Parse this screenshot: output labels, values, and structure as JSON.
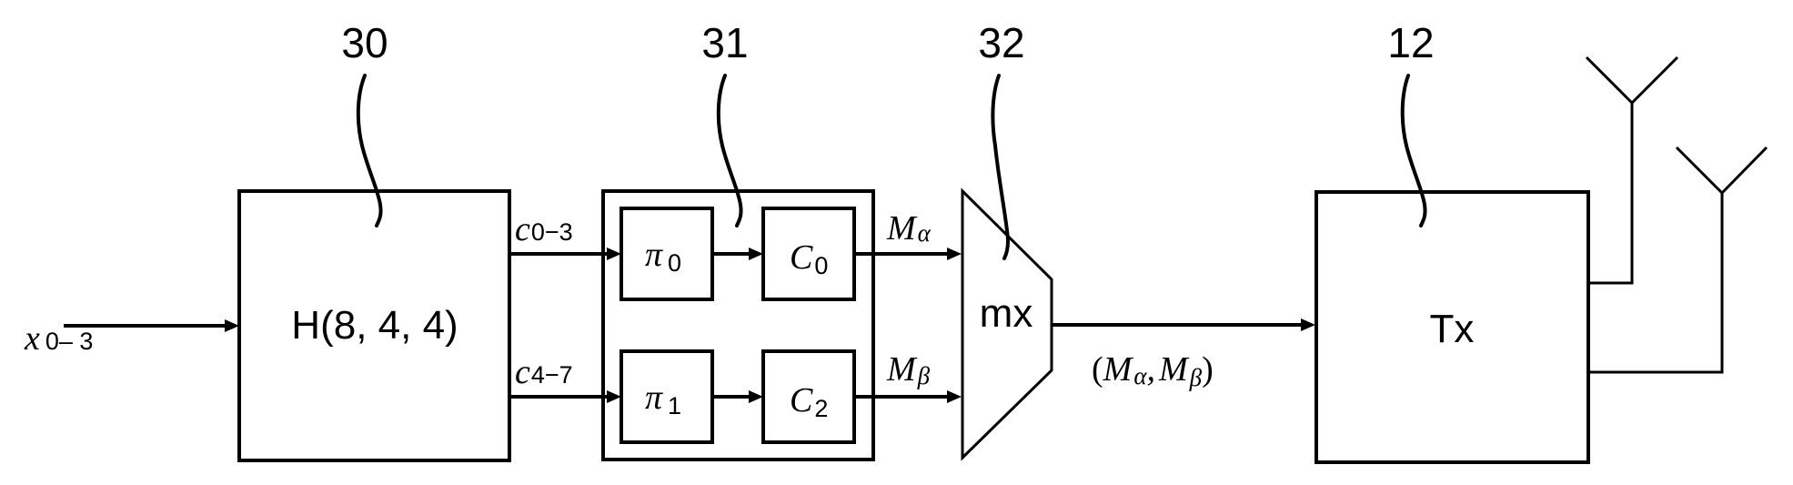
{
  "figure": {
    "reference_numerals": {
      "encoder": "30",
      "interleave_code_block": "31",
      "multiplexer": "32",
      "transmitter": "12"
    },
    "input_signal": {
      "symbol": "x",
      "subscript": "0– 3"
    },
    "blocks": {
      "encoder": {
        "label": "H(8, 4, 4)"
      },
      "interleaver_0": {
        "symbol": "π",
        "subscript": "0"
      },
      "interleaver_1": {
        "symbol": "π",
        "subscript": "1"
      },
      "code_0": {
        "symbol": "C",
        "subscript": "0"
      },
      "code_2": {
        "symbol": "C",
        "subscript": "2"
      },
      "multiplexer": {
        "label": "mx"
      },
      "transmitter": {
        "label": "Tx"
      }
    },
    "signals": {
      "c_upper": {
        "symbol": "c",
        "subscript": "0−3"
      },
      "c_lower": {
        "symbol": "c",
        "subscript": "4−7"
      },
      "m_alpha": {
        "symbol": "M",
        "subscript": "α"
      },
      "m_beta": {
        "symbol": "M",
        "subscript": "β"
      },
      "mux_output": {
        "open": "(",
        "a_symbol": "M",
        "a_subscript": "α",
        "sep": ",",
        "b_symbol": "M",
        "b_subscript": "β",
        "close": ")"
      }
    },
    "antennas": [
      {
        "name": "antenna-1"
      },
      {
        "name": "antenna-2"
      }
    ]
  }
}
